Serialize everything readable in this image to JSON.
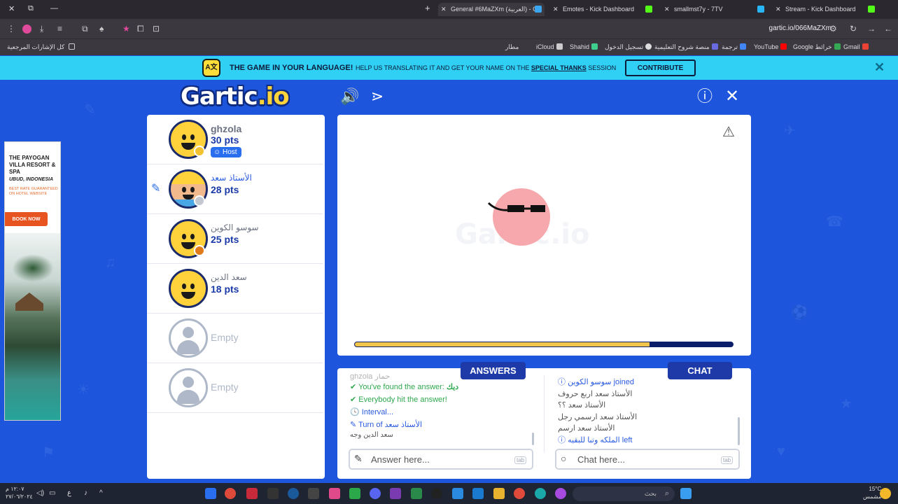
{
  "browser": {
    "tabs": [
      {
        "title": "General #6MaZXm (العربية) - Ga",
        "active": true
      },
      {
        "title": "Emotes - Kick Dashboard",
        "active": false
      },
      {
        "title": "smallmst7y - 7TV",
        "active": false
      },
      {
        "title": "Stream - Kick Dashboard",
        "active": false
      }
    ],
    "new_tab": "+",
    "url": "gartic.io/066MaZXm",
    "bookmarks_left": "كل الإشارات المرجعية",
    "bookmarks": [
      "Gmail",
      "Google خرائط",
      "YouTube",
      "ترجمة",
      "منصة شروح التعليمية",
      "تسجيل الدخول",
      "Shahid",
      "iCloud",
      "مطار"
    ]
  },
  "banner": {
    "icon_text": "A文",
    "title": "THE GAME IN YOUR LANGUAGE!",
    "sub_before": "HELP US TRANSLATING IT AND GET YOUR NAME ON THE",
    "sub_link": "SPECIAL THANKS",
    "sub_after": "SESSION",
    "contribute": "CONTRIBUTE",
    "close": "✕"
  },
  "header": {
    "logo_main": "Gartic",
    "logo_suffix": ".io",
    "sound_icon": "🔊",
    "share_icon": "⋖",
    "info_icon": "ⓘ",
    "close_icon": "✕"
  },
  "ad": {
    "title": "THE PAYOGAN VILLA RESORT & SPA",
    "location": "UBUD, INDONESIA",
    "fine": "BEST RATE GUARANTEED ON HOTEL WEBSITE",
    "button": "BOOK NOW"
  },
  "players": [
    {
      "name": "ghzola",
      "points": "30 pts",
      "host": "Host",
      "dot_color": "#f2c230"
    },
    {
      "name": "الأستاذ سعد",
      "points": "28 pts",
      "drawing": true,
      "dot_color": "#c4c8d0"
    },
    {
      "name": "سوسو الكوين",
      "points": "25 pts",
      "dot_color": "#e07a1a"
    },
    {
      "name": "سعد الدين",
      "points": "18 pts"
    },
    {
      "name": "Empty",
      "empty": true
    },
    {
      "name": "Empty",
      "empty": true
    }
  ],
  "canvas": {
    "watermark": "Gartic.io",
    "report_icon": "⚠",
    "timer_progress": 0.78
  },
  "answers": {
    "tab": "ANSWERS",
    "log": [
      {
        "text": "ghzola حمار",
        "kind": "faded"
      },
      {
        "prefix": "✔",
        "text": "You've found the answer:",
        "extra": "ديك",
        "kind": "green"
      },
      {
        "prefix": "✔",
        "text": "Everybody hit the answer!",
        "kind": "green"
      },
      {
        "prefix": "🕓",
        "text": "Interval...",
        "kind": "blue"
      },
      {
        "prefix": "✎",
        "text": "Turn of",
        "extra": "الأستاذ سعد",
        "kind": "blue"
      },
      {
        "text": "سعد الدين وجه",
        "kind": "dark"
      }
    ],
    "placeholder": "Answer here...",
    "tab_hint": "tab"
  },
  "chat": {
    "tab": "CHAT",
    "log": [
      {
        "prefix": "ⓘ",
        "text": "سوسو الكوين joined",
        "kind": "blue"
      },
      {
        "text": "الأستاذ سعد اربع حروف",
        "kind": "dark"
      },
      {
        "text": "الأستاذ سعد ؟؟",
        "kind": "dark"
      },
      {
        "text": "الأستاذ سعد ارسمي رجل",
        "kind": "dark"
      },
      {
        "text": "الأستاذ سعد ارسم",
        "kind": "dark"
      },
      {
        "prefix": "ⓘ",
        "text": "الملكه وتبا للبقيه left",
        "kind": "blue"
      }
    ],
    "placeholder": "Chat here...",
    "tab_hint": "tab"
  },
  "taskbar": {
    "clock_time": "١٢:٠٧ م",
    "clock_date": "٢٧/٠٦/٢٠٢٤",
    "lang": "ع",
    "search_placeholder": "بحث",
    "weather_temp": "15°C",
    "weather_desc": "مشمس"
  }
}
